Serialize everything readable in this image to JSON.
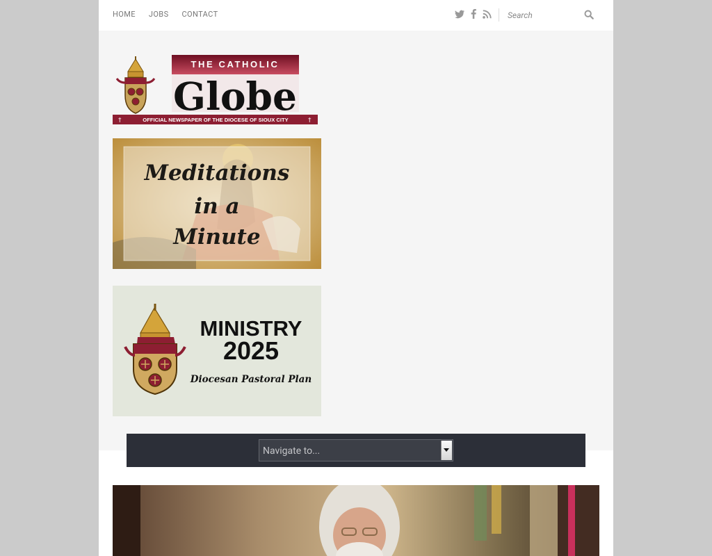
{
  "topnav": {
    "items": [
      {
        "label": "HOME"
      },
      {
        "label": "JOBS"
      },
      {
        "label": "CONTACT"
      }
    ]
  },
  "social": {
    "icons": [
      "twitter-icon",
      "facebook-icon",
      "rss-icon"
    ]
  },
  "search": {
    "placeholder": "Search"
  },
  "logo": {
    "top_line": "THE CATHOLIC",
    "name": "Globe",
    "tagline": "OFFICIAL NEWSPAPER OF THE DIOCESE OF SIOUX CITY"
  },
  "meditations_banner": {
    "line1": "Meditations",
    "line2": "in a",
    "line3": "Minute"
  },
  "ministry_banner": {
    "title": "MINISTRY",
    "year": "2025",
    "subtitle": "Diocesan Pastoral Plan"
  },
  "nav_select": {
    "label": "Navigate to..."
  },
  "colors": {
    "outer_background": "#cbcbcb",
    "page_background": "#f5f5f5",
    "nav_background": "#2c2f38",
    "logo_maroon": "#8d1e32"
  }
}
